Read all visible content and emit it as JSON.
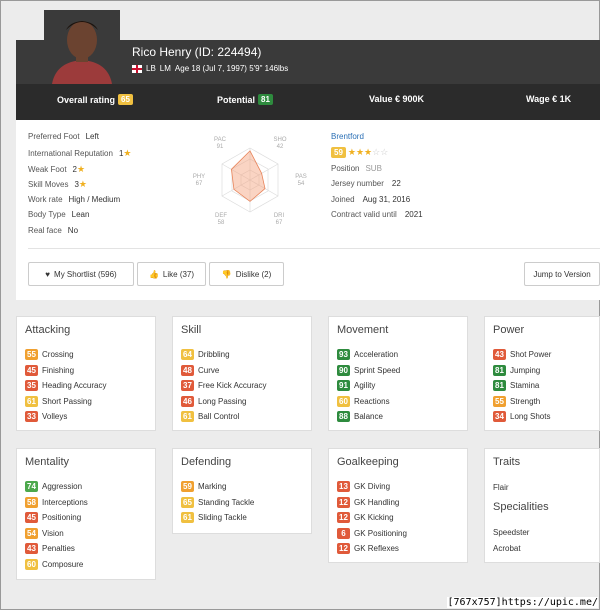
{
  "player": {
    "name": "Rico Henry (ID: 224494)",
    "positions": [
      "LB",
      "LM"
    ],
    "info": "Age 18 (Jul 7, 1997) 5'9\" 146lbs"
  },
  "ratings": {
    "overall_label": "Overall rating",
    "overall": "65",
    "potential_label": "Potential",
    "potential": "81",
    "value_label": "Value € 900K",
    "wage_label": "Wage € 1K"
  },
  "profile": [
    {
      "label": "Preferred Foot",
      "value": "Left"
    },
    {
      "label": "International Reputation",
      "value": "1"
    },
    {
      "label": "Weak Foot",
      "value": "2"
    },
    {
      "label": "Skill Moves",
      "value": "3"
    },
    {
      "label": "Work rate",
      "value": "High / Medium"
    },
    {
      "label": "Body Type",
      "value": "Lean"
    },
    {
      "label": "Real face",
      "value": "No"
    }
  ],
  "radar": {
    "pac": "PAC",
    "pac_v": "91",
    "sho": "SHO",
    "sho_v": "42",
    "pas": "PAS",
    "pas_v": "54",
    "dri": "DRI",
    "dri_v": "67",
    "def": "DEF",
    "def_v": "58",
    "phy": "PHY",
    "phy_v": "67",
    "values": [
      91,
      42,
      54,
      67,
      58,
      67
    ]
  },
  "team": {
    "name": "Brentford",
    "rating": "59",
    "stars": 3,
    "position_label": "Position",
    "position": "SUB",
    "jersey_label": "Jersey number",
    "jersey": "22",
    "joined_label": "Joined",
    "joined": "Aug 31, 2016",
    "contract_label": "Contract valid until",
    "contract": "2021"
  },
  "buttons": {
    "shortlist": "My Shortlist (596)",
    "like": "Like (37)",
    "dislike": "Dislike (2)",
    "jump": "Jump to Version"
  },
  "cards": {
    "attacking": {
      "title": "Attacking",
      "items": [
        [
          "55",
          "Crossing"
        ],
        [
          "45",
          "Finishing"
        ],
        [
          "35",
          "Heading Accuracy"
        ],
        [
          "61",
          "Short Passing"
        ],
        [
          "33",
          "Volleys"
        ]
      ]
    },
    "skill": {
      "title": "Skill",
      "items": [
        [
          "64",
          "Dribbling"
        ],
        [
          "48",
          "Curve"
        ],
        [
          "37",
          "Free Kick Accuracy"
        ],
        [
          "46",
          "Long Passing"
        ],
        [
          "61",
          "Ball Control"
        ]
      ]
    },
    "movement": {
      "title": "Movement",
      "items": [
        [
          "93",
          "Acceleration"
        ],
        [
          "90",
          "Sprint Speed"
        ],
        [
          "91",
          "Agility"
        ],
        [
          "60",
          "Reactions"
        ],
        [
          "88",
          "Balance"
        ]
      ]
    },
    "power": {
      "title": "Power",
      "items": [
        [
          "43",
          "Shot Power"
        ],
        [
          "81",
          "Jumping"
        ],
        [
          "81",
          "Stamina"
        ],
        [
          "55",
          "Strength"
        ],
        [
          "34",
          "Long Shots"
        ]
      ]
    },
    "mentality": {
      "title": "Mentality",
      "items": [
        [
          "74",
          "Aggression"
        ],
        [
          "58",
          "Interceptions"
        ],
        [
          "45",
          "Positioning"
        ],
        [
          "54",
          "Vision"
        ],
        [
          "43",
          "Penalties"
        ],
        [
          "60",
          "Composure"
        ]
      ]
    },
    "defending": {
      "title": "Defending",
      "items": [
        [
          "59",
          "Marking"
        ],
        [
          "65",
          "Standing Tackle"
        ],
        [
          "61",
          "Sliding Tackle"
        ]
      ]
    },
    "goalkeeping": {
      "title": "Goalkeeping",
      "items": [
        [
          "13",
          "GK Diving"
        ],
        [
          "12",
          "GK Handling"
        ],
        [
          "12",
          "GK Kicking"
        ],
        [
          "6",
          "GK Positioning"
        ],
        [
          "12",
          "GK Reflexes"
        ]
      ]
    },
    "traits": {
      "title": "Traits",
      "trait": "Flair",
      "spec_title": "Specialities",
      "specs": [
        "Speedster",
        "Acrobat"
      ]
    }
  },
  "watermark": "[767x757]https://upic.me/"
}
